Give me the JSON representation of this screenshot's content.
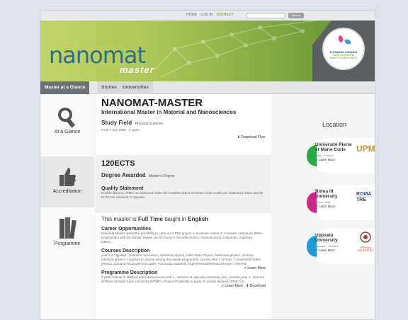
{
  "topnav": {
    "home": "HOME",
    "login": "LOG IN",
    "contact": "CONTACT",
    "search_button": "Search"
  },
  "brand": {
    "logo_main": "nanomat",
    "logo_sub": "master",
    "badge_title": "european campus",
    "badge_line": "NANOSCIENCE & NANOTECHNOLOGIES"
  },
  "tabs": [
    {
      "label": "Master at a Glance"
    },
    {
      "label": "Stories"
    },
    {
      "label": "Universities"
    }
  ],
  "sidebar": [
    {
      "label": "At a Glance",
      "icon": "magnifier-icon"
    },
    {
      "label": "Accreditation",
      "icon": "thumbs-up-icon"
    },
    {
      "label": "Programme",
      "icon": "books-icon"
    }
  ],
  "main": {
    "title": "NANOMAT-MASTER",
    "subtitle": "International Master in Material and Nanosciences",
    "study_field_label": "Study Field",
    "study_field_value": "Physical sciences",
    "dates": "From 7 Sep 2009 · 2 years",
    "download_flyer": "Download Flyer",
    "ects": "120ECTS",
    "degree_label": "Degree Awarded",
    "degree_value": "Master's Degree",
    "quality_title": "Quality Statement",
    "quality_text": "Double diploma UPMC-UU delivered under the condition that a minimum of 30 credits are obtained in Paris and 30 ECTS are obtained in Uppsala.",
    "fulltime_prefix": "This master is",
    "fulltime": "Full Time",
    "taught_in": "taught in",
    "language": "English",
    "career_title": "Career Opportunities",
    "career_text": "Nanomat Master opens the possibility to carry out a PhD project in academic research or private companies (80%). Employment with the Master degree can be found in microelectronics, semiconductor companies, expertise, patent...",
    "courses_title": "Courses Description",
    "courses_text": "year 1 in Uppsala : Quantum mechanics, statistical physics, Solid State Physics, Molecular physics, Surface Interface physics + courses to choose among the master programme courses Year 2 in Paris : Condensed matter physics, Liocation local spectroscopies, Functional materials, Experimental/theoretical project, intership",
    "learn_more": "Learn More",
    "programme_title": "Programme Description",
    "programme_text": "2 years Master in Material and Nanosciences year 1 : lectures at Uppsala University (UU), Sweden year 2 : lectures at Pierre et Marie Curie University (UPMC) - France Possibility to apply for double diploma UPMC-UU",
    "download": "Download"
  },
  "location": {
    "title": "Location",
    "universities": [
      {
        "name": "Université Pierre et Marie Curie",
        "city": "Paris - France",
        "link": "Learn More",
        "logo": "UPMC",
        "color": "#2aa84a"
      },
      {
        "name": "Roma III University",
        "city": "Roma - Italy",
        "link": "Learn More",
        "logo": "ROMA TRE",
        "color": "#cc2a8a"
      },
      {
        "name": "Uppsala University",
        "city": "Uppsala - Sweden",
        "link": "Learn More",
        "logo": "UPPSALA UNIVERSITET",
        "color": "#1f9ad8"
      }
    ]
  }
}
